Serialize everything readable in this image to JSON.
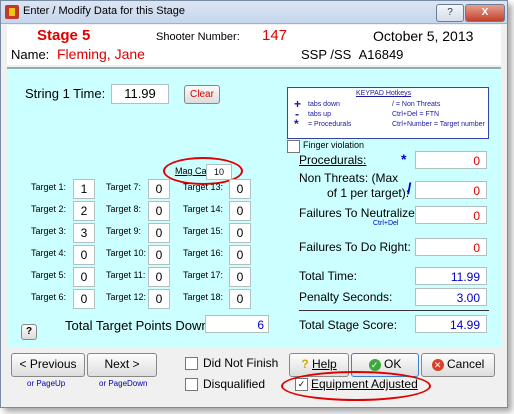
{
  "window": {
    "title": "Enter / Modify Data for this Stage",
    "help_label": "?",
    "close_label": "X"
  },
  "header": {
    "stage": "Stage  5",
    "shooter_label": "Shooter Number:",
    "shooter_number": "147",
    "date": "October  5, 2013",
    "name_label": "Name:",
    "name": "Fleming, Jane",
    "class_label": "SSP /SS",
    "class_id": "A16849"
  },
  "string": {
    "label": "String 1 Time:",
    "value": "11.99",
    "clear_label": "Clear"
  },
  "keypad": {
    "title": "KEYPAD Hotkeys",
    "lines": [
      "tabs down",
      "tabs up",
      "= Procedurals",
      "/ = Non Threats",
      "Ctrl+Del = FTN",
      "Ctrl+Number = Target number"
    ],
    "symbols": [
      "+",
      "-",
      "*"
    ]
  },
  "magcap": {
    "label": "Mag Cap",
    "value": "10"
  },
  "targets": {
    "labels": [
      "Target 1:",
      "Target 2:",
      "Target 3:",
      "Target 4:",
      "Target 5:",
      "Target 6:",
      "Target 7:",
      "Target 8:",
      "Target 9:",
      "Target 10:",
      "Target 11:",
      "Target 12:",
      "Target 13:",
      "Target 14:",
      "Target 15:",
      "Target 16:",
      "Target 17:",
      "Target 18:"
    ],
    "values": [
      "1",
      "2",
      "3",
      "0",
      "0",
      "0",
      "0",
      "0",
      "0",
      "0",
      "0",
      "0",
      "0",
      "0",
      "0",
      "0",
      "0",
      "0"
    ]
  },
  "total_points": {
    "label": "Total Target Points Down:",
    "value": "6"
  },
  "help_small": "?",
  "penalties": {
    "finger_label": "Finger violation",
    "procedurals_label": "Procedurals:",
    "procedurals_star": "*",
    "procedurals_value": "0",
    "nonthreats_label_1": "Non Threats: (Max",
    "nonthreats_label_2": "of 1 per target):",
    "nonthreats_slash": "/",
    "nonthreats_value": "0",
    "ftn_label": "Failures To Neutralize:",
    "ftn_hint": "Ctrl+Del",
    "ftn_value": "0",
    "fdr_label": "Failures To Do Right:",
    "fdr_value": "0"
  },
  "totals": {
    "time_label": "Total Time:",
    "time_value": "11.99",
    "penalty_label": "Penalty Seconds:",
    "penalty_value": "3.00",
    "score_label": "Total Stage Score:",
    "score_value": "14.99"
  },
  "footer": {
    "prev_label": "< Previous",
    "prev_hint": "or PageUp",
    "next_label": "Next >",
    "next_hint": "or PageDown",
    "dnf_label": "Did Not Finish",
    "dq_label": "Disqualified",
    "help_label": "Help",
    "ok_label": "OK",
    "cancel_label": "Cancel",
    "equip_label": "Equipment Adjusted",
    "equip_check": "✓"
  },
  "colors": {
    "panel": "#ccffff",
    "accent_red": "#e00000",
    "accent_blue": "#0000cc"
  }
}
